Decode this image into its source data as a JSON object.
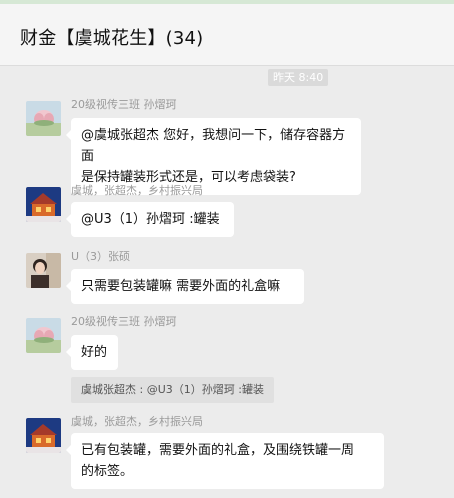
{
  "chat": {
    "title": "财金【虞城花生】(34)",
    "timestamp": "昨天 8:40"
  },
  "messages": [
    {
      "sender": "20级视传三班 孙熠珂",
      "lines": [
        "@虞城张超杰 您好，我想问一下，储存容器方面",
        "是保持罐装形式还是，可以考虑袋装?"
      ]
    },
    {
      "sender": "虞城，张超杰，乡村振兴局",
      "lines": [
        "@U3（1）孙熠珂 :罐装"
      ]
    },
    {
      "sender": "U（3）张硕",
      "lines": [
        "只需要包装罐嘛 需要外面的礼盒嘛"
      ]
    },
    {
      "sender": "20级视传三班 孙熠珂",
      "lines": [
        "好的"
      ],
      "quote": "虞城张超杰 : @U3（1）孙熠珂 :罐装"
    },
    {
      "sender": "虞城，张超杰，乡村振兴局",
      "lines": [
        "已有包装罐，需要外面的礼盒，及围绕铁罐一周",
        "的标签。"
      ]
    }
  ]
}
